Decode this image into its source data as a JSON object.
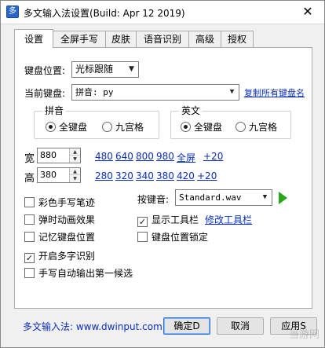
{
  "window": {
    "title": "多文输入法设置(Build: Apr 12 2019)",
    "icon_glyph": "多",
    "close_glyph": "✕"
  },
  "tabs": [
    {
      "label": "设置",
      "active": true
    },
    {
      "label": "全屏手写",
      "active": false
    },
    {
      "label": "皮肤",
      "active": false
    },
    {
      "label": "语音识别",
      "active": false
    },
    {
      "label": "高级",
      "active": false
    },
    {
      "label": "授权",
      "active": false
    }
  ],
  "settings": {
    "keyboard_position_label": "键盘位置:",
    "keyboard_position_value": "光标跟随",
    "current_keyboard_label": "当前键盘:",
    "current_keyboard_value": "拼音: py",
    "copy_keyboards_link": "复制所有键盘名",
    "pinyin_group": {
      "title": "拼音",
      "options": [
        {
          "label": "全键盘",
          "selected": true
        },
        {
          "label": "九宫格",
          "selected": false
        }
      ]
    },
    "english_group": {
      "title": "英文",
      "options": [
        {
          "label": "全键盘",
          "selected": true
        },
        {
          "label": "九宫格",
          "selected": false
        }
      ]
    },
    "width_label": "宽",
    "width_value": "880",
    "width_presets": [
      "480",
      "640",
      "800",
      "980",
      "全屏",
      "+20"
    ],
    "height_label": "高",
    "height_value": "380",
    "height_presets": [
      "280",
      "320",
      "340",
      "380",
      "420",
      "+20"
    ],
    "options_left": [
      {
        "label": "彩色手写笔迹",
        "checked": false
      },
      {
        "label": "弹时动画效果",
        "checked": false
      },
      {
        "label": "记忆键盘位置",
        "checked": false
      },
      {
        "label": "开启多字识别",
        "checked": true
      },
      {
        "label": "手写自动输出第一候选",
        "checked": false
      }
    ],
    "key_sound_label": "按键音:",
    "key_sound_value": "Standard.wav",
    "options_right": [
      {
        "label": "显示工具栏",
        "checked": true
      },
      {
        "label": "键盘位置锁定",
        "checked": false
      }
    ],
    "edit_toolbar_link": "修改工具栏"
  },
  "footer": {
    "brand_text": "多文输入法: www.dwinput.com",
    "ok_label": "确定D",
    "cancel_label": "取消",
    "apply_label": "应用S"
  },
  "watermark": "当游网",
  "colors": {
    "link": "#0a2fbf",
    "play_green": "#27a81a",
    "default_button_border": "#2a6fd6"
  }
}
